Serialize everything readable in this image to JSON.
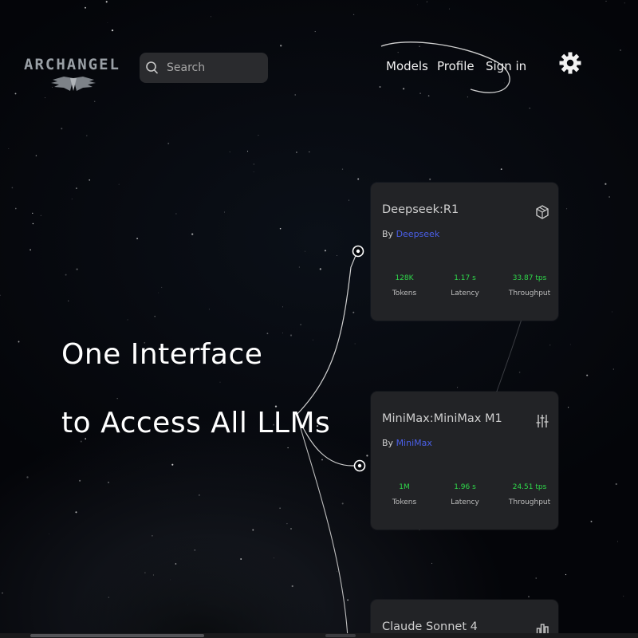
{
  "brand": {
    "name": "ARCHANGEL"
  },
  "search": {
    "placeholder": "Search"
  },
  "nav": {
    "models": "Models",
    "profile": "Profile",
    "signin": "Sign in"
  },
  "icons": {
    "search": "search-icon",
    "settings": "gear-icon",
    "node": "target-node-icon"
  },
  "hero": {
    "line1": "One Interface",
    "line2": "to Access All LLMs"
  },
  "colors": {
    "accent_link": "#4a5fe8",
    "stat_value": "#2fd84a",
    "card_bg": "#222326"
  },
  "cards": [
    {
      "title": "Deepseek:R1",
      "by_label": "By",
      "provider": "Deepseek",
      "icon": "cube-icon",
      "stats": [
        {
          "value": "128K",
          "label": "Tokens"
        },
        {
          "value": "1.17 s",
          "label": "Latency"
        },
        {
          "value": "33.87 tps",
          "label": "Throughput"
        }
      ]
    },
    {
      "title": "MiniMax:MiniMax M1",
      "by_label": "By",
      "provider": "MiniMax",
      "icon": "sliders-icon",
      "stats": [
        {
          "value": "1M",
          "label": "Tokens"
        },
        {
          "value": "1.96 s",
          "label": "Latency"
        },
        {
          "value": "24.51 tps",
          "label": "Throughput"
        }
      ]
    },
    {
      "title": "Claude Sonnet 4",
      "icon": "chart-icon"
    }
  ]
}
